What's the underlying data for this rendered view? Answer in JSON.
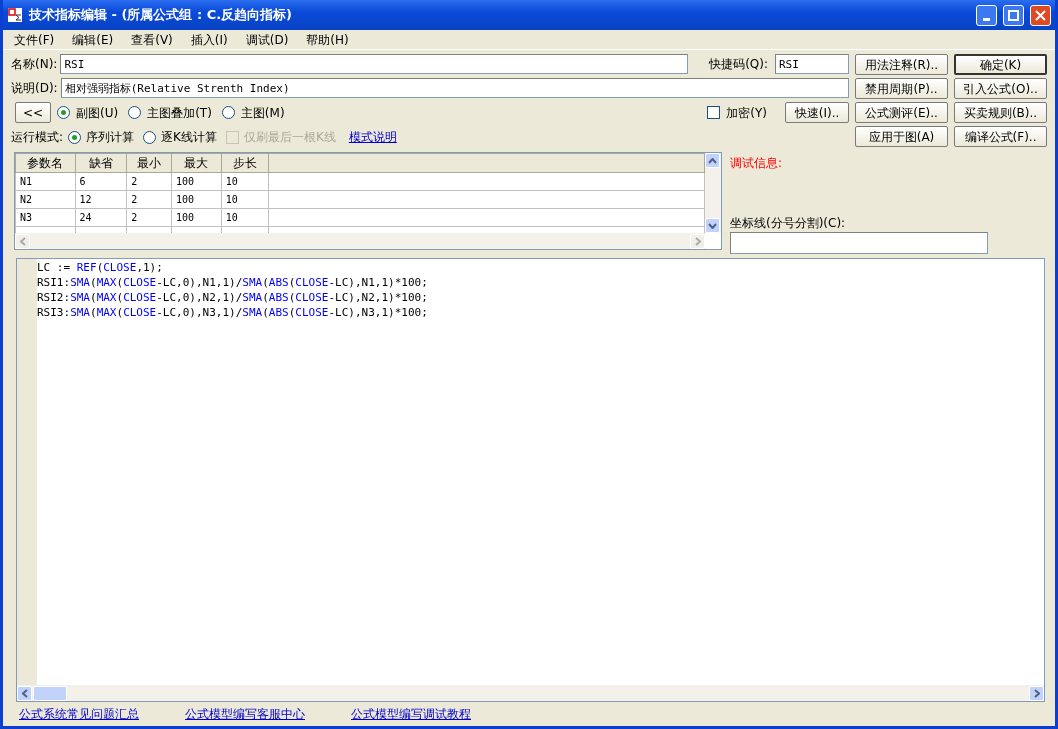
{
  "window": {
    "title": "技术指标编辑 - (所属公式组 : C.反趋向指标)"
  },
  "menu": [
    "文件(F)",
    "编辑(E)",
    "查看(V)",
    "插入(I)",
    "调试(D)",
    "帮助(H)"
  ],
  "name_field": {
    "label": "名称(N):",
    "value": "RSI"
  },
  "shortcut_field": {
    "label": "快捷码(Q):",
    "value": "RSI"
  },
  "description_field": {
    "label": "说明(D):",
    "value": "相对强弱指标(Relative Strenth Index)"
  },
  "collapse_button": "<<",
  "chart_type": [
    {
      "label": "副图(U)",
      "selected": true
    },
    {
      "label": "主图叠加(T)",
      "selected": false
    },
    {
      "label": "主图(M)",
      "selected": false
    }
  ],
  "encrypt": {
    "label": "加密(Y)",
    "checked": false
  },
  "quick_button": "快速(I)..",
  "run_mode": {
    "label": "运行模式:",
    "options": [
      {
        "label": "序列计算",
        "selected": true
      },
      {
        "label": "逐K线计算",
        "selected": false
      }
    ],
    "refresh_last": {
      "label": "仅刷最后一根K线",
      "checked": false,
      "disabled": true
    },
    "help_link": "模式说明"
  },
  "buttons": [
    [
      "用法注释(R)..",
      "禁用周期(P)..",
      "公式测评(E)..",
      "应用于图(A)"
    ],
    [
      "确定(K)",
      "引入公式(O)..",
      "买卖规则(B)..",
      "编译公式(F).."
    ]
  ],
  "params": {
    "columns": [
      "参数名",
      "缺省",
      "最小",
      "最大",
      "步长"
    ],
    "rows": [
      [
        "N1",
        "6",
        "2",
        "100",
        "10"
      ],
      [
        "N2",
        "12",
        "2",
        "100",
        "10"
      ],
      [
        "N3",
        "24",
        "2",
        "100",
        "10"
      ]
    ]
  },
  "debug_label": "调试信息:",
  "axis_field": {
    "label": "坐标线(分号分割)(C):"
  },
  "code": [
    [
      {
        "t": "LC := ",
        "kind": "plain"
      },
      {
        "t": "REF",
        "kind": "fn"
      },
      {
        "t": "(",
        "kind": "plain"
      },
      {
        "t": "CLOSE",
        "kind": "fn"
      },
      {
        "t": ",1);",
        "kind": "plain"
      }
    ],
    [
      {
        "t": "RSI1:",
        "kind": "plain"
      },
      {
        "t": "SMA",
        "kind": "fn"
      },
      {
        "t": "(",
        "kind": "plain"
      },
      {
        "t": "MAX",
        "kind": "fn"
      },
      {
        "t": "(",
        "kind": "plain"
      },
      {
        "t": "CLOSE",
        "kind": "fn"
      },
      {
        "t": "-LC,0),N1,1)/",
        "kind": "plain"
      },
      {
        "t": "SMA",
        "kind": "fn"
      },
      {
        "t": "(",
        "kind": "plain"
      },
      {
        "t": "ABS",
        "kind": "fn"
      },
      {
        "t": "(",
        "kind": "plain"
      },
      {
        "t": "CLOSE",
        "kind": "fn"
      },
      {
        "t": "-LC),N1,1)*100;",
        "kind": "plain"
      }
    ],
    [
      {
        "t": "RSI2:",
        "kind": "plain"
      },
      {
        "t": "SMA",
        "kind": "fn"
      },
      {
        "t": "(",
        "kind": "plain"
      },
      {
        "t": "MAX",
        "kind": "fn"
      },
      {
        "t": "(",
        "kind": "plain"
      },
      {
        "t": "CLOSE",
        "kind": "fn"
      },
      {
        "t": "-LC,0),N2,1)/",
        "kind": "plain"
      },
      {
        "t": "SMA",
        "kind": "fn"
      },
      {
        "t": "(",
        "kind": "plain"
      },
      {
        "t": "ABS",
        "kind": "fn"
      },
      {
        "t": "(",
        "kind": "plain"
      },
      {
        "t": "CLOSE",
        "kind": "fn"
      },
      {
        "t": "-LC),N2,1)*100;",
        "kind": "plain"
      }
    ],
    [
      {
        "t": "RSI3:",
        "kind": "plain"
      },
      {
        "t": "SMA",
        "kind": "fn"
      },
      {
        "t": "(",
        "kind": "plain"
      },
      {
        "t": "MAX",
        "kind": "fn"
      },
      {
        "t": "(",
        "kind": "plain"
      },
      {
        "t": "CLOSE",
        "kind": "fn"
      },
      {
        "t": "-LC,0),N3,1)/",
        "kind": "plain"
      },
      {
        "t": "SMA",
        "kind": "fn"
      },
      {
        "t": "(",
        "kind": "plain"
      },
      {
        "t": "ABS",
        "kind": "fn"
      },
      {
        "t": "(",
        "kind": "plain"
      },
      {
        "t": "CLOSE",
        "kind": "fn"
      },
      {
        "t": "-LC),N3,1)*100;",
        "kind": "plain"
      }
    ]
  ],
  "links": [
    "公式系统常见问题汇总",
    "公式模型编写客服中心",
    "公式模型编写调试教程"
  ]
}
